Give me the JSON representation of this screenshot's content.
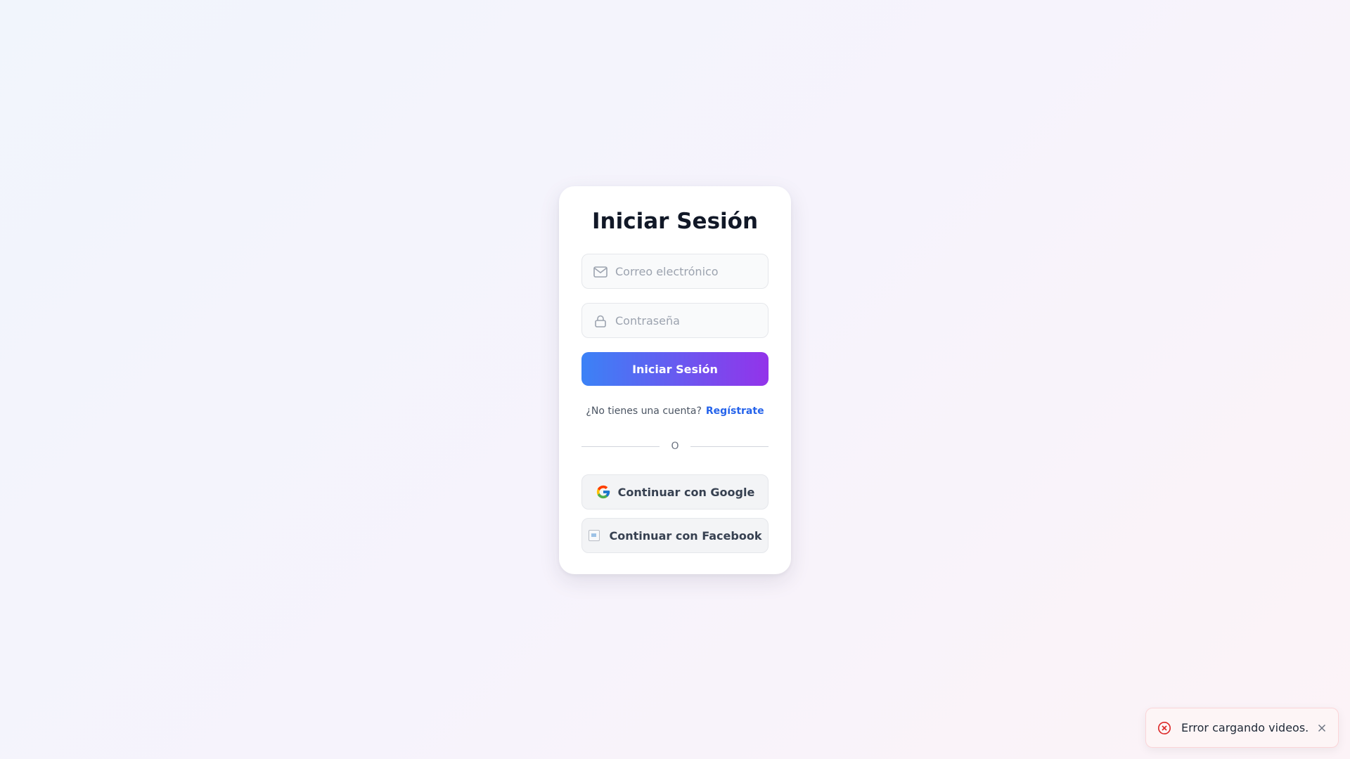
{
  "login": {
    "title": "Iniciar Sesión",
    "email_placeholder": "Correo electrónico",
    "email_icon": "mail-icon",
    "password_placeholder": "Contraseña",
    "password_icon": "lock-icon",
    "submit_label": "Iniciar Sesión",
    "signup_prompt": "¿No tienes una cuenta?",
    "signup_link": "Regístrate",
    "divider_text": "O",
    "google_label": "Continuar con Google",
    "google_icon": "google-icon",
    "facebook_label": "Continuar con Facebook",
    "facebook_icon": "facebook-icon"
  },
  "toast": {
    "message": "Error cargando videos.",
    "icon": "error-circle-icon",
    "close_icon": "close-icon"
  },
  "colors": {
    "primary_gradient_start": "#3b82f6",
    "primary_gradient_end": "#9333ea",
    "link": "#2563eb",
    "error": "#dc2626"
  }
}
